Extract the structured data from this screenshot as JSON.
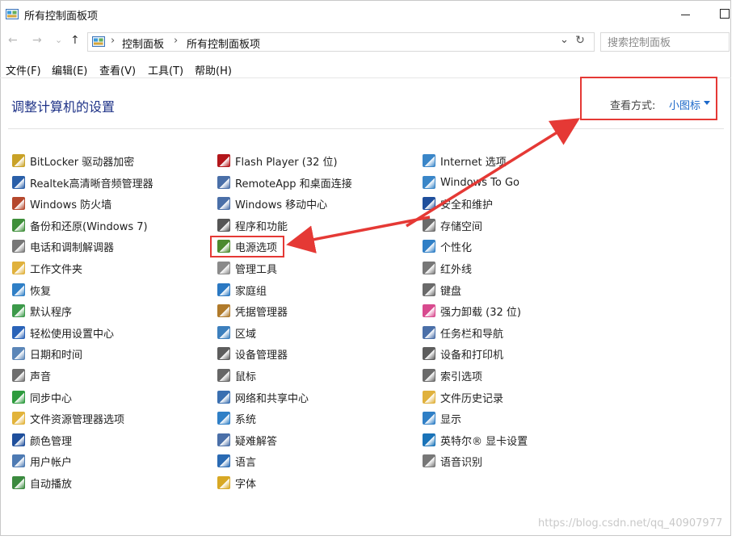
{
  "window": {
    "title": "所有控制面板项"
  },
  "nav": {
    "back": "←",
    "forward": "→",
    "recent": "⌄",
    "up": "↑"
  },
  "address": {
    "crumbs": [
      "控制面板",
      "所有控制面板项"
    ],
    "separator": "›",
    "dropdown": "⌄",
    "refresh": "↻"
  },
  "search": {
    "placeholder": "搜索控制面板"
  },
  "menu": [
    "文件(F)",
    "编辑(E)",
    "查看(V)",
    "工具(T)",
    "帮助(H)"
  ],
  "heading": "调整计算机的设置",
  "view": {
    "label": "查看方式:",
    "value": "小图标"
  },
  "columns": [
    [
      {
        "label": "BitLocker 驱动器加密",
        "icon": "bitlocker-icon",
        "color": "#c9a227"
      },
      {
        "label": "Realtek高清晰音频管理器",
        "icon": "realtek-audio-icon",
        "color": "#2a5fa8"
      },
      {
        "label": "Windows 防火墙",
        "icon": "firewall-icon",
        "color": "#b5482d"
      },
      {
        "label": "备份和还原(Windows 7)",
        "icon": "backup-icon",
        "color": "#3f8f3a"
      },
      {
        "label": "电话和调制解调器",
        "icon": "phone-modem-icon",
        "color": "#777777"
      },
      {
        "label": "工作文件夹",
        "icon": "work-folders-icon",
        "color": "#e0b13c"
      },
      {
        "label": "恢复",
        "icon": "recovery-icon",
        "color": "#2f7fc6"
      },
      {
        "label": "默认程序",
        "icon": "default-programs-icon",
        "color": "#3c9a4a"
      },
      {
        "label": "轻松使用设置中心",
        "icon": "ease-of-access-icon",
        "color": "#2a63b8"
      },
      {
        "label": "日期和时间",
        "icon": "date-time-icon",
        "color": "#5b86b8"
      },
      {
        "label": "声音",
        "icon": "sound-icon",
        "color": "#6e6e6e"
      },
      {
        "label": "同步中心",
        "icon": "sync-center-icon",
        "color": "#2e9b3e"
      },
      {
        "label": "文件资源管理器选项",
        "icon": "explorer-options-icon",
        "color": "#e2b33a"
      },
      {
        "label": "颜色管理",
        "icon": "color-management-icon",
        "color": "#1f4f9c"
      },
      {
        "label": "用户帐户",
        "icon": "user-accounts-icon",
        "color": "#4d7ab3"
      },
      {
        "label": "自动播放",
        "icon": "autoplay-icon",
        "color": "#3b8a3f"
      }
    ],
    [
      {
        "label": "Flash Player (32 位)",
        "icon": "flash-player-icon",
        "color": "#b3161b"
      },
      {
        "label": "RemoteApp 和桌面连接",
        "icon": "remoteapp-icon",
        "color": "#4a6fa8"
      },
      {
        "label": "Windows 移动中心",
        "icon": "mobility-center-icon",
        "color": "#4a6fa8"
      },
      {
        "label": "程序和功能",
        "icon": "programs-features-icon",
        "color": "#555555"
      },
      {
        "label": "电源选项",
        "icon": "power-options-icon",
        "color": "#4d8a2e"
      },
      {
        "label": "管理工具",
        "icon": "admin-tools-icon",
        "color": "#8a8a8a"
      },
      {
        "label": "家庭组",
        "icon": "homegroup-icon",
        "color": "#2a78c2"
      },
      {
        "label": "凭据管理器",
        "icon": "credential-manager-icon",
        "color": "#b07a2a"
      },
      {
        "label": "区域",
        "icon": "region-icon",
        "color": "#3c7fbd"
      },
      {
        "label": "设备管理器",
        "icon": "device-manager-icon",
        "color": "#5d5d5d"
      },
      {
        "label": "鼠标",
        "icon": "mouse-icon",
        "color": "#666666"
      },
      {
        "label": "网络和共享中心",
        "icon": "network-sharing-icon",
        "color": "#3a6fb0"
      },
      {
        "label": "系统",
        "icon": "system-icon",
        "color": "#2f7fc6"
      },
      {
        "label": "疑难解答",
        "icon": "troubleshooting-icon",
        "color": "#4a6fa8"
      },
      {
        "label": "语言",
        "icon": "language-icon",
        "color": "#2a6ab3"
      },
      {
        "label": "字体",
        "icon": "fonts-icon",
        "color": "#d8a824"
      }
    ],
    [
      {
        "label": "Internet 选项",
        "icon": "internet-options-icon",
        "color": "#3a86c8"
      },
      {
        "label": "Windows To Go",
        "icon": "windows-to-go-icon",
        "color": "#3a86c8"
      },
      {
        "label": "安全和维护",
        "icon": "security-maintenance-icon",
        "color": "#1f4f9c"
      },
      {
        "label": "存储空间",
        "icon": "storage-spaces-icon",
        "color": "#6a6a6a"
      },
      {
        "label": "个性化",
        "icon": "personalization-icon",
        "color": "#2f7fc6"
      },
      {
        "label": "红外线",
        "icon": "infrared-icon",
        "color": "#777777"
      },
      {
        "label": "键盘",
        "icon": "keyboard-icon",
        "color": "#6a6a6a"
      },
      {
        "label": "强力卸载 (32 位)",
        "icon": "uninstaller-icon",
        "color": "#d84a8e"
      },
      {
        "label": "任务栏和导航",
        "icon": "taskbar-navigation-icon",
        "color": "#4a6fa8"
      },
      {
        "label": "设备和打印机",
        "icon": "devices-printers-icon",
        "color": "#5d5d5d"
      },
      {
        "label": "索引选项",
        "icon": "indexing-options-icon",
        "color": "#6a6a6a"
      },
      {
        "label": "文件历史记录",
        "icon": "file-history-icon",
        "color": "#e0b13c"
      },
      {
        "label": "显示",
        "icon": "display-icon",
        "color": "#2f7fc6"
      },
      {
        "label": "英特尔® 显卡设置",
        "icon": "intel-graphics-icon",
        "color": "#1a73b8"
      },
      {
        "label": "语音识别",
        "icon": "speech-recognition-icon",
        "color": "#777777"
      }
    ]
  ],
  "highlight": {
    "target": "电源选项",
    "annotation_color": "#e53935"
  },
  "watermark": "https://blog.csdn.net/qq_40907977"
}
